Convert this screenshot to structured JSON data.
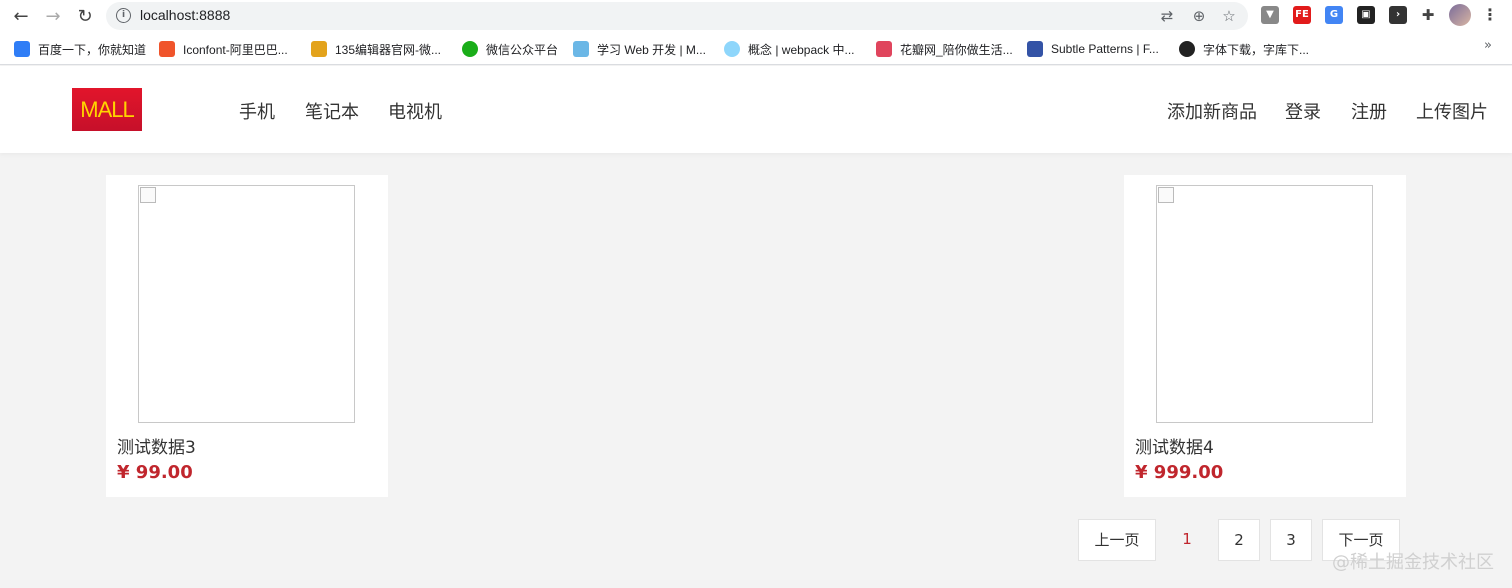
{
  "browser": {
    "url": "localhost:8888",
    "bookmarks": [
      {
        "label": "百度一下，你就知道",
        "color": "#2f7df6"
      },
      {
        "label": "Iconfont-阿里巴巴...",
        "color": "#f0542b"
      },
      {
        "label": "135编辑器官网-微...",
        "color": "#e3a31c"
      },
      {
        "label": "微信公众平台",
        "color": "#1aad19"
      },
      {
        "label": "学习 Web 开发 | M...",
        "color": "#6bb7e6"
      },
      {
        "label": "概念 | webpack 中...",
        "color": "#8ed6fb"
      },
      {
        "label": "花瓣网_陪你做生活...",
        "color": "#e0455d"
      },
      {
        "label": "Subtle Patterns | F...",
        "color": "#3453a6"
      },
      {
        "label": "字体下载，字库下...",
        "color": "#222222"
      }
    ],
    "more_bookmarks": "»"
  },
  "site": {
    "logo": "MALL",
    "nav_left": [
      "手机",
      "笔记本",
      "电视机"
    ],
    "nav_right": [
      "添加新商品",
      "登录",
      "注册",
      "上传图片"
    ]
  },
  "products": [
    {
      "name": "测试数据3",
      "price": "¥ 99.00"
    },
    {
      "name": "测试数据4",
      "price": "¥ 999.00"
    }
  ],
  "pagination": {
    "prev": "上一页",
    "pages": [
      "1",
      "2",
      "3"
    ],
    "current": "1",
    "next": "下一页"
  },
  "watermark": "@稀土掘金技术社区",
  "colors": {
    "accent": "#c0262d",
    "logo_bg": "#e2152b",
    "logo_text": "#ffd400"
  }
}
